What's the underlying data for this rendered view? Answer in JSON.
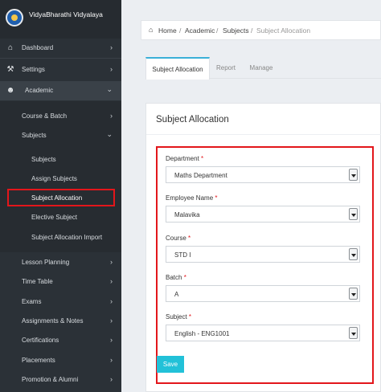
{
  "brand": {
    "name": "VidyaBharathi Vidyalaya"
  },
  "sidebar": {
    "items": [
      {
        "label": "Dashboard",
        "icon": "home-icon"
      },
      {
        "label": "Settings",
        "icon": "wrench-icon"
      },
      {
        "label": "Academic",
        "icon": "users-icon"
      }
    ],
    "academic_sub": [
      {
        "label": "Course & Batch"
      },
      {
        "label": "Subjects"
      }
    ],
    "subjects_sub": [
      {
        "label": "Subjects"
      },
      {
        "label": "Assign Subjects"
      },
      {
        "label": "Subject Allocation"
      },
      {
        "label": "Elective Subject"
      },
      {
        "label": "Subject Allocation Import"
      }
    ],
    "more_items": [
      {
        "label": "Lesson Planning"
      },
      {
        "label": "Time Table"
      },
      {
        "label": "Exams"
      },
      {
        "label": "Assignments & Notes"
      },
      {
        "label": "Certifications"
      },
      {
        "label": "Placements"
      },
      {
        "label": "Promotion & Alumni"
      }
    ]
  },
  "breadcrumb": {
    "home": "Home",
    "items": [
      "Academic",
      "Subjects"
    ],
    "current": "Subject Allocation",
    "separator": "/"
  },
  "tabs": [
    {
      "label": "Subject Allocation",
      "active": true
    },
    {
      "label": "Report",
      "active": false
    },
    {
      "label": "Manage",
      "active": false
    }
  ],
  "panel": {
    "title": "Subject Allocation",
    "required_marker": "*",
    "fields": [
      {
        "label": "Department",
        "value": "Maths Department"
      },
      {
        "label": "Employee Name",
        "value": "Malavika"
      },
      {
        "label": "Course",
        "value": "STD I"
      },
      {
        "label": "Batch",
        "value": "A"
      },
      {
        "label": "Subject",
        "value": "English - ENG1001"
      }
    ],
    "save_label": "Save"
  },
  "colors": {
    "sidebar_bg": "#2b3137",
    "accent": "#22c1d8",
    "highlight": "#e3161b",
    "tab_active_border": "#3ab0d8"
  }
}
